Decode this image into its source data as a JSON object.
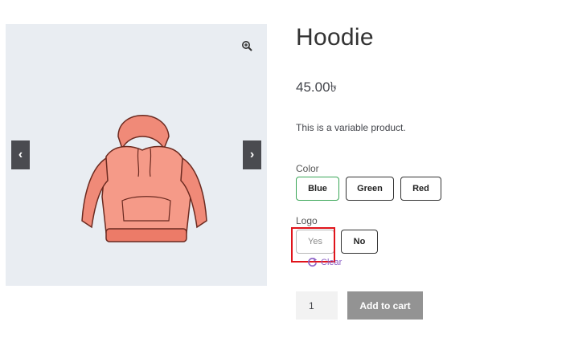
{
  "gallery": {
    "zoom_icon": "magnifier-plus-icon",
    "prev_icon": "chevron-left-icon",
    "next_icon": "chevron-right-icon",
    "prev_glyph": "‹",
    "next_glyph": "›",
    "image": "hoodie-illustration"
  },
  "product": {
    "title": "Hoodie",
    "price": "45.00৳",
    "description": "This is a variable product."
  },
  "attributes": {
    "color": {
      "label": "Color",
      "options": [
        "Blue",
        "Green",
        "Red"
      ],
      "selected": "Blue"
    },
    "logo": {
      "label": "Logo",
      "options": [
        "Yes",
        "No"
      ]
    }
  },
  "clear": {
    "label": "Clear",
    "icon": "refresh-icon"
  },
  "cart": {
    "quantity": "1",
    "add_label": "Add to cart"
  },
  "colors": {
    "selected_border": "#3aa657",
    "highlight": "#e0141b",
    "button_bg": "#939393",
    "clear_link": "#8e63c7",
    "gallery_bg": "#e9edf2"
  }
}
